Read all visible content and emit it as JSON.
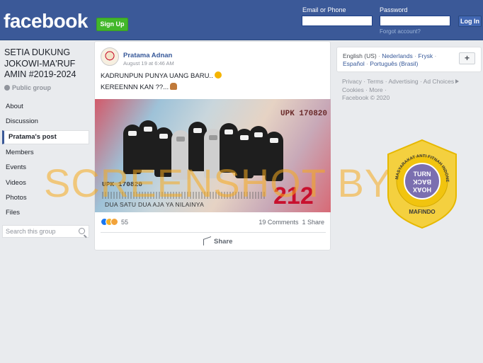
{
  "header": {
    "logo": "facebook",
    "signup_label": "Sign Up",
    "email_label": "Email or Phone",
    "password_label": "Password",
    "forgot_label": "Forgot account?",
    "login_label": "Log In"
  },
  "group": {
    "name": "SETIA DUKUNG JOKOWI-MA'RUF AMIN #2019-2024",
    "privacy": "Public group",
    "nav": [
      {
        "label": "About"
      },
      {
        "label": "Discussion"
      },
      {
        "label": "Pratama's post"
      },
      {
        "label": "Members"
      },
      {
        "label": "Events"
      },
      {
        "label": "Videos"
      },
      {
        "label": "Photos"
      },
      {
        "label": "Files"
      }
    ],
    "search_placeholder": "Search this group"
  },
  "post": {
    "author": "Pratama Adnan",
    "date": "August 19 at 6:46 AM",
    "line1": "KADRUNPUN PUNYA UANG BARU..",
    "line2": "KEREENNN KAN ??...",
    "image": {
      "serial": "UPK 170820",
      "number": "212",
      "caption": "DUA SATU DUA AJA YA NILAINYA"
    },
    "reaction_count": "55",
    "comments": "19 Comments",
    "shares": "1 Share",
    "share_label": "Share"
  },
  "sidebar_right": {
    "current_language": "English (US)",
    "languages": [
      "Nederlands",
      "Frysk",
      "Español",
      "Português (Brasil)"
    ],
    "footer_links": [
      "Privacy",
      "Terms",
      "Advertising",
      "Ad Choices",
      "Cookies",
      "More"
    ],
    "copyright": "Facebook © 2020"
  },
  "watermark": "SCREENSHOT BY",
  "badge": {
    "ring_text": "MASYARAKAT ANTI FITNAH INDONESIA",
    "center_lines": [
      "TURN",
      "BACK",
      "HOAX"
    ],
    "bottom": "MAFINDO",
    "color": "#f4d03f"
  }
}
